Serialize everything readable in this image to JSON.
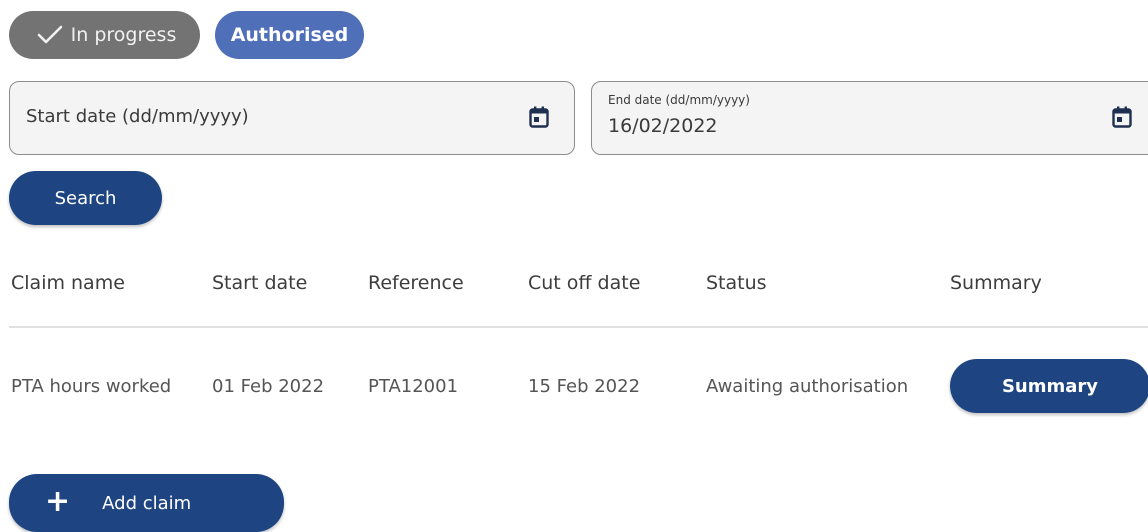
{
  "filters": {
    "in_progress_label": "In progress",
    "authorised_label": "Authorised"
  },
  "start_date": {
    "placeholder": "Start date (dd/mm/yyyy)",
    "value": ""
  },
  "end_date": {
    "label": "End date (dd/mm/yyyy)",
    "value": "16/02/2022"
  },
  "search_button_label": "Search",
  "table": {
    "headers": [
      "Claim name",
      "Start date",
      "Reference",
      "Cut off date",
      "Status",
      "Summary"
    ],
    "rows": [
      {
        "claim_name": "PTA hours worked",
        "start_date": "01 Feb 2022",
        "reference": "PTA12001",
        "cut_off_date": "15 Feb 2022",
        "status": "Awaiting authorisation",
        "summary_button_label": "Summary"
      }
    ]
  },
  "add_claim_label": "Add claim",
  "colors": {
    "primary": "#1e4582",
    "chip_selected": "#4f6fb8",
    "chip_unselected": "#737373"
  }
}
